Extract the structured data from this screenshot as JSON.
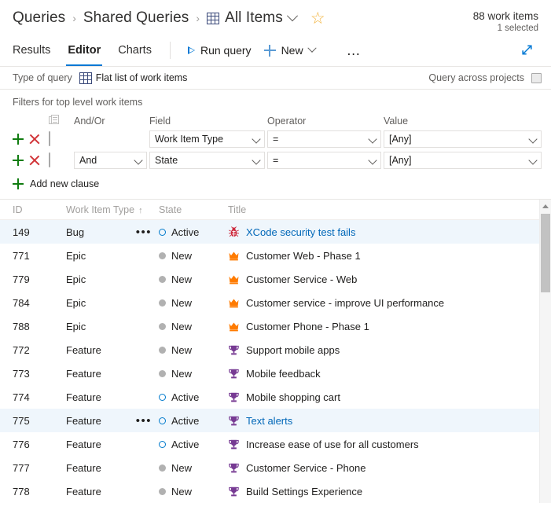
{
  "header": {
    "breadcrumb": [
      {
        "label": "Queries",
        "icon": null
      },
      {
        "label": "Shared Queries",
        "icon": null
      },
      {
        "label": "All Items",
        "icon": "grid-icon"
      }
    ],
    "separator": "›",
    "favorite_icon": "star-icon",
    "count_main": "88 work items",
    "count_sub": "1 selected"
  },
  "commandbar": {
    "tabs": [
      {
        "label": "Results",
        "active": false
      },
      {
        "label": "Editor",
        "active": true
      },
      {
        "label": "Charts",
        "active": false
      }
    ],
    "run_query_label": "Run query",
    "run_query_icon": "play-icon",
    "new_label": "New",
    "new_icon": "plus-icon",
    "overflow_label": "…",
    "expand_icon": "expand-diagonal-icon"
  },
  "query_type": {
    "label": "Type of query",
    "value": "Flat list of work items",
    "value_icon": "grid-icon",
    "across_projects_label": "Query across projects",
    "across_projects_checked": false
  },
  "filters": {
    "title": "Filters for top level work items",
    "columns": {
      "group": "",
      "andor": "And/Or",
      "field": "Field",
      "operator": "Operator",
      "value": "Value"
    },
    "group_icon": "grouping-icon",
    "add_icon": "plus-icon",
    "delete_icon": "close-icon",
    "rows": [
      {
        "andor": "",
        "field": "Work Item Type",
        "operator": "=",
        "value": "[Any]",
        "checked": false
      },
      {
        "andor": "And",
        "field": "State",
        "operator": "=",
        "value": "[Any]",
        "checked": false
      }
    ],
    "add_clause_label": "Add new clause"
  },
  "grid": {
    "columns": [
      {
        "key": "id",
        "label": "ID",
        "sort": ""
      },
      {
        "key": "type",
        "label": "Work Item Type",
        "sort": "↑"
      },
      {
        "key": "state",
        "label": "State",
        "sort": ""
      },
      {
        "key": "title",
        "label": "Title",
        "sort": ""
      }
    ],
    "rows": [
      {
        "id": "149",
        "type": "Bug",
        "state": "Active",
        "title": "XCode security test fails",
        "icon": "bug-icon",
        "selected": true,
        "menu": true,
        "link": true
      },
      {
        "id": "771",
        "type": "Epic",
        "state": "New",
        "title": "Customer Web - Phase 1",
        "icon": "crown-icon",
        "selected": false,
        "menu": false,
        "link": false
      },
      {
        "id": "779",
        "type": "Epic",
        "state": "New",
        "title": "Customer Service - Web",
        "icon": "crown-icon",
        "selected": false,
        "menu": false,
        "link": false
      },
      {
        "id": "784",
        "type": "Epic",
        "state": "New",
        "title": "Customer service - improve UI performance",
        "icon": "crown-icon",
        "selected": false,
        "menu": false,
        "link": false
      },
      {
        "id": "788",
        "type": "Epic",
        "state": "New",
        "title": "Customer Phone - Phase 1",
        "icon": "crown-icon",
        "selected": false,
        "menu": false,
        "link": false
      },
      {
        "id": "772",
        "type": "Feature",
        "state": "New",
        "title": "Support mobile apps",
        "icon": "trophy-icon",
        "selected": false,
        "menu": false,
        "link": false
      },
      {
        "id": "773",
        "type": "Feature",
        "state": "New",
        "title": "Mobile feedback",
        "icon": "trophy-icon",
        "selected": false,
        "menu": false,
        "link": false
      },
      {
        "id": "774",
        "type": "Feature",
        "state": "Active",
        "title": "Mobile shopping cart",
        "icon": "trophy-icon",
        "selected": false,
        "menu": false,
        "link": false
      },
      {
        "id": "775",
        "type": "Feature",
        "state": "Active",
        "title": "Text alerts",
        "icon": "trophy-icon",
        "selected": true,
        "menu": true,
        "link": true
      },
      {
        "id": "776",
        "type": "Feature",
        "state": "Active",
        "title": "Increase ease of use for all customers",
        "icon": "trophy-icon",
        "selected": false,
        "menu": false,
        "link": false
      },
      {
        "id": "777",
        "type": "Feature",
        "state": "New",
        "title": "Customer Service - Phone",
        "icon": "trophy-icon",
        "selected": false,
        "menu": false,
        "link": false
      },
      {
        "id": "778",
        "type": "Feature",
        "state": "New",
        "title": "Build Settings Experience",
        "icon": "trophy-icon",
        "selected": false,
        "menu": false,
        "link": false
      }
    ],
    "row_menu_icon": "more-actions-icon"
  },
  "colors": {
    "accent": "#0078d4",
    "link": "#0067b8",
    "selected_row": "#eff6fc",
    "bug": "#cc293d",
    "epic": "#ff7b00",
    "feature": "#773b93",
    "state_active": "#007acc",
    "state_new": "#b1b1b1",
    "add": "#107c10",
    "delete": "#d13438",
    "star": "#f2b33d"
  }
}
